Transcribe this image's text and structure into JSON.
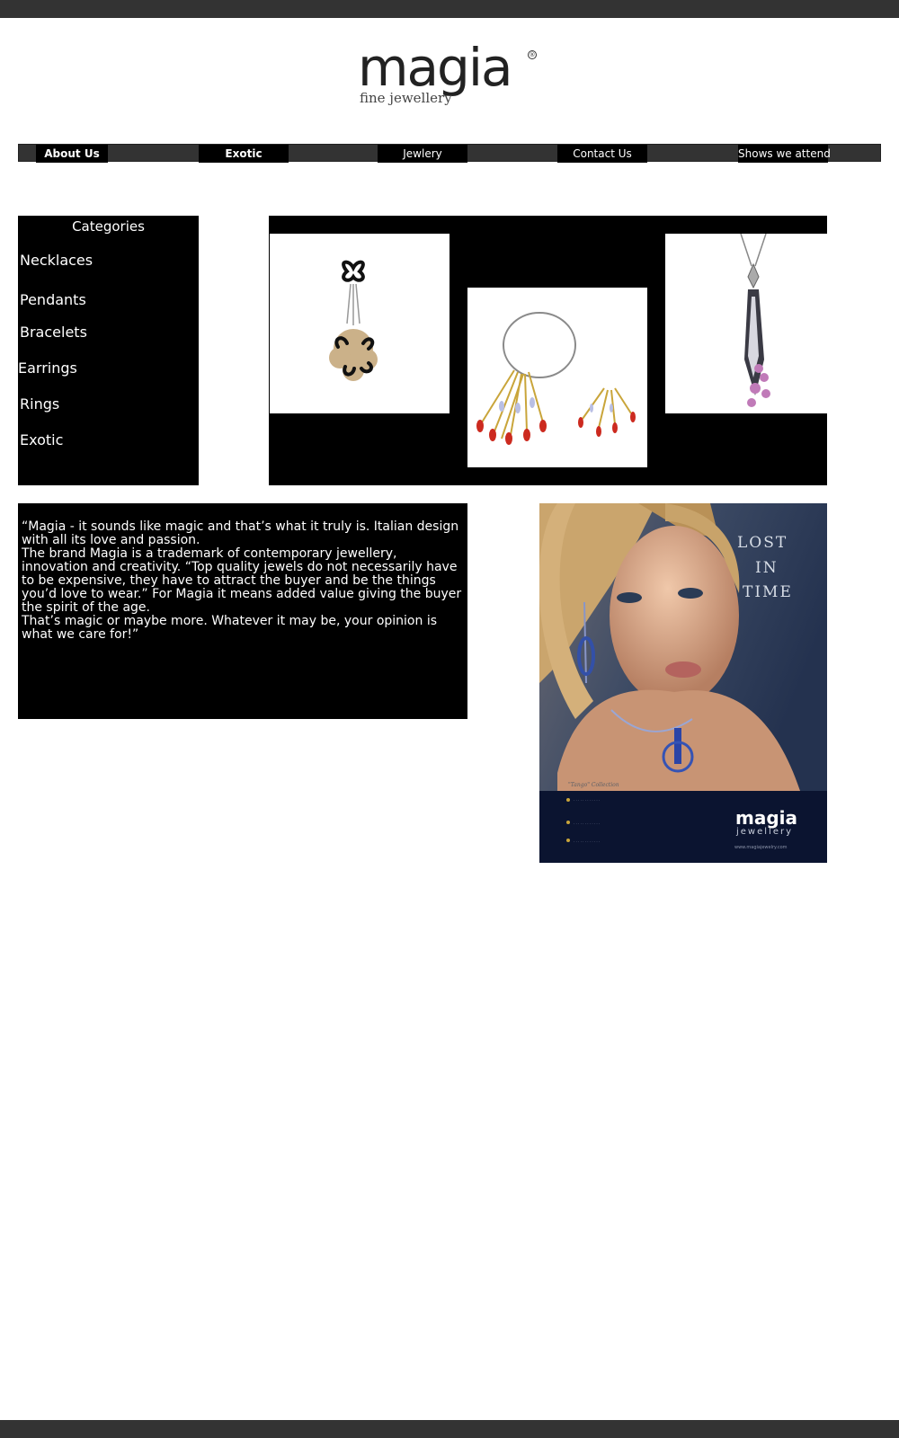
{
  "logo": {
    "wordmark": "magia",
    "registered": "®",
    "tagline": "fine jewellery"
  },
  "nav": {
    "items": [
      {
        "label": "About Us"
      },
      {
        "label": "Exotic"
      },
      {
        "label": "Jewlery"
      },
      {
        "label": "Contact Us"
      },
      {
        "label": "Shows we attend"
      }
    ]
  },
  "categories": {
    "title": "Categories",
    "items": [
      {
        "label": "Necklaces"
      },
      {
        "label": "Pendants"
      },
      {
        "label": "Bracelets"
      },
      {
        "label": "Earrings"
      },
      {
        "label": "Rings"
      },
      {
        "label": "Exotic"
      }
    ]
  },
  "quote": {
    "paragraphs": [
      "“Magia - it sounds like magic and that’s what it truly is. Italian design with all its love and passion.",
      "The brand Magia is a trademark of contemporary jewellery, innovation and creativity. “Top quality jewels do not necessarily have to be expensive, they have to attract the buyer and be the things you’d love to wear.” For Magia it means added value giving the buyer the spirit of the age.",
      "That’s magic or maybe more. Whatever it may be, your opinion is what we care for!”"
    ]
  },
  "ad": {
    "headline": [
      "LOST",
      "IN",
      "TIME"
    ],
    "collection": "\"Tango\" Collection",
    "brand": "magia",
    "brand_sub": "jewellery",
    "url": "www.magiajewelry.com"
  },
  "colors": {
    "bar": "#333333",
    "panel": "#000000",
    "text_on_panel": "#ffffff"
  }
}
